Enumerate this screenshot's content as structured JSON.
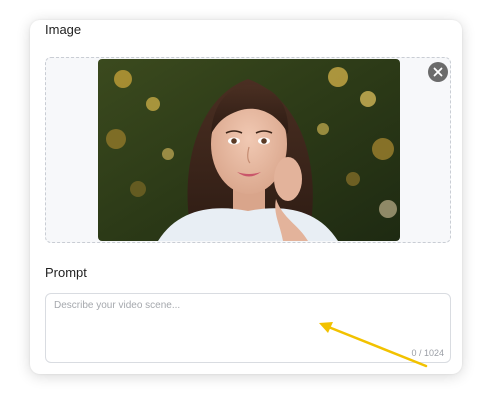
{
  "image_section": {
    "label": "Image",
    "remove_icon": "close-icon"
  },
  "prompt_section": {
    "label": "Prompt",
    "placeholder": "Describe your video scene...",
    "value": "",
    "counter": "0 / 1024"
  },
  "colors": {
    "annotation_arrow": "#f2c200",
    "remove_button": "#6b6b6b"
  }
}
